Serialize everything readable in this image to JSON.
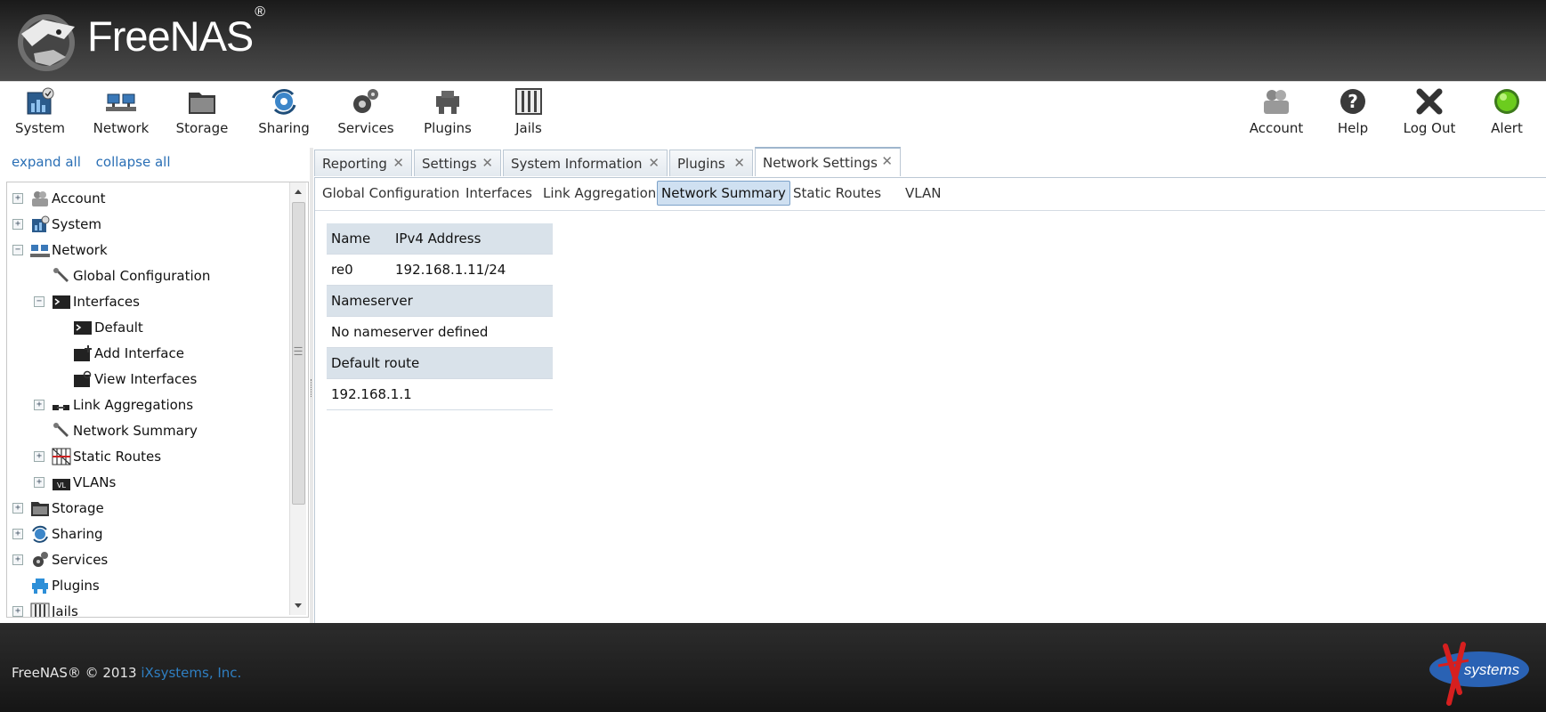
{
  "brand": {
    "name": "FreeNAS",
    "reg": "®"
  },
  "toolbar": {
    "left": [
      {
        "id": "system",
        "label": "System"
      },
      {
        "id": "network",
        "label": "Network"
      },
      {
        "id": "storage",
        "label": "Storage"
      },
      {
        "id": "sharing",
        "label": "Sharing"
      },
      {
        "id": "services",
        "label": "Services"
      },
      {
        "id": "plugins",
        "label": "Plugins"
      },
      {
        "id": "jails",
        "label": "Jails"
      }
    ],
    "right": [
      {
        "id": "account",
        "label": "Account"
      },
      {
        "id": "help",
        "label": "Help"
      },
      {
        "id": "logout",
        "label": "Log Out"
      },
      {
        "id": "alert",
        "label": "Alert"
      }
    ]
  },
  "tree_controls": {
    "expand_all": "expand all",
    "collapse_all": "collapse all"
  },
  "tree": [
    {
      "label": "Account",
      "expander": "+",
      "icon": "account-icon"
    },
    {
      "label": "System",
      "expander": "+",
      "icon": "system-icon"
    },
    {
      "label": "Network",
      "expander": "−",
      "icon": "network-icon"
    },
    {
      "label": "Global Configuration",
      "expander": "",
      "icon": "wrench-icon"
    },
    {
      "label": "Interfaces",
      "expander": "−",
      "icon": "terminal-icon"
    },
    {
      "label": "Default",
      "expander": "",
      "icon": "terminal-icon"
    },
    {
      "label": "Add Interface",
      "expander": "",
      "icon": "add-interface-icon"
    },
    {
      "label": "View Interfaces",
      "expander": "",
      "icon": "view-interfaces-icon"
    },
    {
      "label": "Link Aggregations",
      "expander": "+",
      "icon": "link-aggregation-icon"
    },
    {
      "label": "Network Summary",
      "expander": "",
      "icon": "wrench-icon"
    },
    {
      "label": "Static Routes",
      "expander": "+",
      "icon": "static-routes-icon"
    },
    {
      "label": "VLANs",
      "expander": "+",
      "icon": "vlan-icon"
    },
    {
      "label": "Storage",
      "expander": "+",
      "icon": "storage-icon"
    },
    {
      "label": "Sharing",
      "expander": "+",
      "icon": "sharing-icon"
    },
    {
      "label": "Services",
      "expander": "+",
      "icon": "services-icon"
    },
    {
      "label": "Plugins",
      "expander": "",
      "icon": "plugins-icon"
    },
    {
      "label": "Jails",
      "expander": "+",
      "icon": "jails-icon"
    }
  ],
  "tabs": [
    {
      "label": "Reporting",
      "active": false
    },
    {
      "label": "Settings",
      "active": false
    },
    {
      "label": "System Information",
      "active": false
    },
    {
      "label": "Plugins",
      "active": false
    },
    {
      "label": "Network Settings",
      "active": true
    }
  ],
  "subtabs": [
    {
      "label": "Global Configuration",
      "active": false
    },
    {
      "label": "Interfaces",
      "active": false
    },
    {
      "label": "Link Aggregation",
      "active": false
    },
    {
      "label": "Network Summary",
      "active": true
    },
    {
      "label": "Static Routes",
      "active": false
    },
    {
      "label": "VLAN",
      "active": false
    }
  ],
  "summary": {
    "col_name": "Name",
    "col_ipv4": "IPv4 Address",
    "interfaces": [
      {
        "name": "re0",
        "ipv4": "192.168.1.11/24"
      }
    ],
    "nameserver_header": "Nameserver",
    "nameserver_value": "No nameserver defined",
    "route_header": "Default route",
    "route_value": "192.168.1.1"
  },
  "footer": {
    "text": "FreeNAS® © 2013",
    "link": "iXsystems, Inc."
  },
  "colors": {
    "link": "#2a6fb5",
    "header_dark": "#2a2a2a",
    "table_header": "#d9e2ea",
    "active_subtab": "#cfe0f1"
  }
}
